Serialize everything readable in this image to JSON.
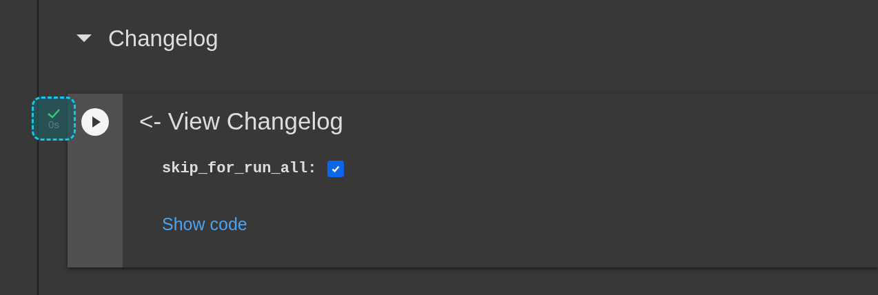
{
  "section": {
    "title": "Changelog",
    "expanded": true
  },
  "cell": {
    "status": {
      "kind": "success",
      "time": "0s"
    },
    "title": "<- View Changelog",
    "params": [
      {
        "label": "skip_for_run_all:",
        "checked": true
      }
    ],
    "show_code": "Show code"
  }
}
